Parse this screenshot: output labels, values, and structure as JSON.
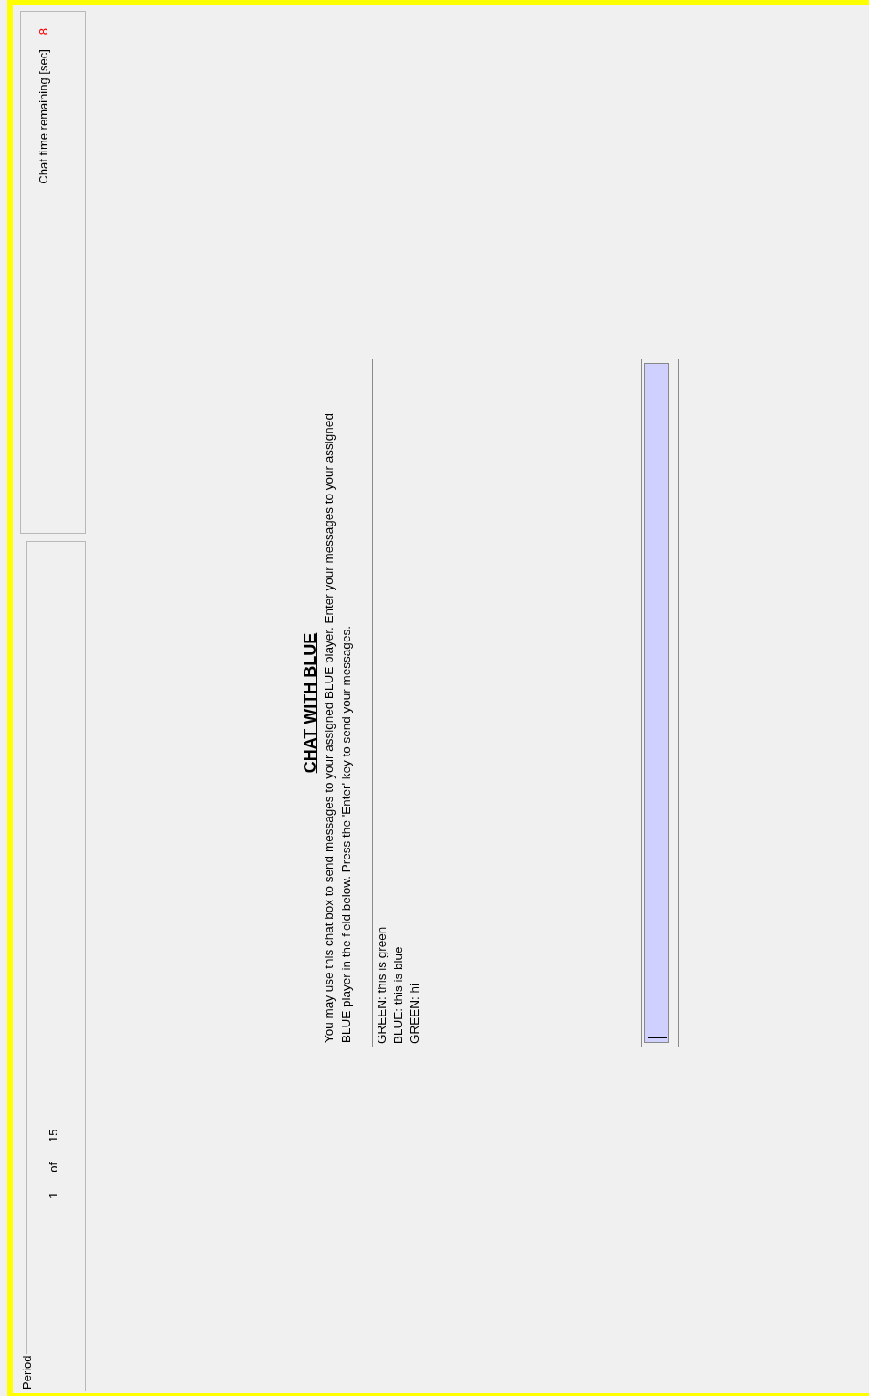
{
  "period": {
    "legend": "Period",
    "current": "1",
    "of": "of",
    "total": "15"
  },
  "timer": {
    "label": "Chat time remaining [sec]",
    "value": "8"
  },
  "chat": {
    "title": "CHAT WITH BLUE",
    "instructions": "You may use this chat box to send messages to your assigned BLUE player.  Enter your messages to your assigned BLUE player in the field below.  Press the 'Enter' key to send your messages.",
    "messages": [
      "GREEN: this is green",
      "BLUE: this is blue",
      "GREEN: hi"
    ]
  }
}
